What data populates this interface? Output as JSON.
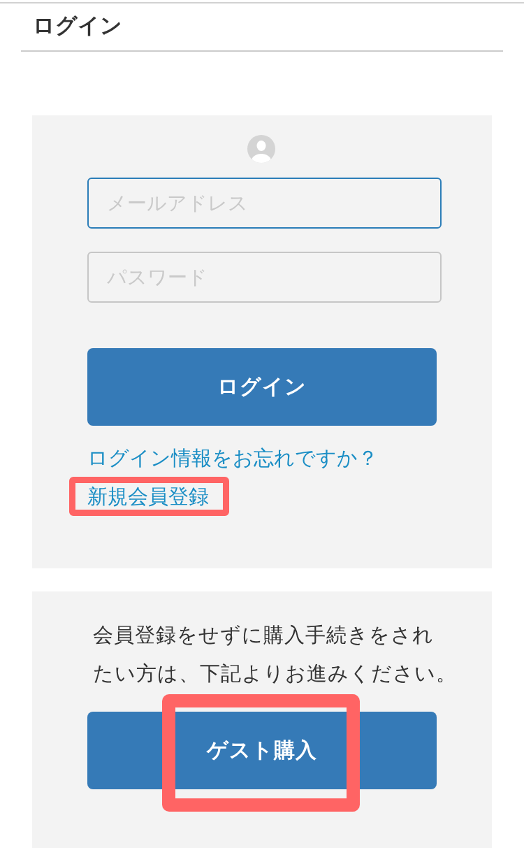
{
  "header": {
    "title": "ログイン"
  },
  "login_panel": {
    "fields": [
      {
        "placeholder": "メールアドレス",
        "focused": true
      },
      {
        "placeholder": "パスワード",
        "focused": false
      }
    ],
    "button": {
      "label": "ログイン"
    },
    "links": [
      {
        "text": "ログイン情報をお忘れですか？",
        "highlighted": false
      },
      {
        "text": "新規会員登録",
        "highlighted": true
      }
    ]
  },
  "guest_panel": {
    "note_lines": [
      "会員登録をせずに購入手続きをされ",
      "たい方は、下記よりお進みください。"
    ],
    "button": {
      "label": "ゲスト購入",
      "highlighted": true
    }
  }
}
